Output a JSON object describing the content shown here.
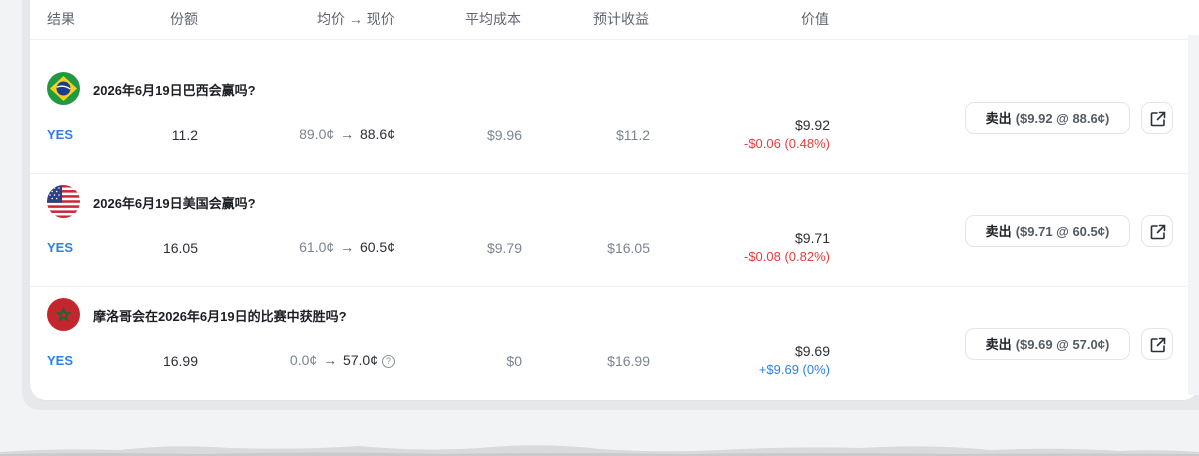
{
  "header": {
    "outcome": "结果",
    "shares": "份额",
    "price": "均价 → 现价",
    "avg_cost": "平均成本",
    "expected_return": "预计收益",
    "value": "价值"
  },
  "colors": {
    "accent_blue": "#2f7fe0",
    "loss_red": "#e03e3e"
  },
  "rows": [
    {
      "flag_icon": "brazil-flag-icon",
      "title": "2026年6月19日巴西会赢吗?",
      "outcome": "YES",
      "shares": "11.2",
      "avg_price": "89.0¢",
      "arrow": "→",
      "current_price": "88.6¢",
      "avg_cost": "$9.96",
      "expected_return": "$11.2",
      "value": "$9.92",
      "value_change": "-$0.06 (0.48%)",
      "sell_label": "卖出",
      "sell_detail": "($9.92 @ 88.6¢)"
    },
    {
      "flag_icon": "usa-flag-icon",
      "title": "2026年6月19日美国会赢吗?",
      "outcome": "YES",
      "shares": "16.05",
      "avg_price": "61.0¢",
      "arrow": "→",
      "current_price": "60.5¢",
      "avg_cost": "$9.79",
      "expected_return": "$16.05",
      "value": "$9.71",
      "value_change": "-$0.08 (0.82%)",
      "sell_label": "卖出",
      "sell_detail": "($9.71 @ 60.5¢)"
    },
    {
      "flag_icon": "morocco-flag-icon",
      "title": "摩洛哥会在2026年6月19日的比赛中获胜吗?",
      "outcome": "YES",
      "shares": "16.99",
      "avg_price": "0.0¢",
      "arrow": "→",
      "current_price": "57.0¢",
      "help_glyph": "?",
      "avg_cost": "$0",
      "expected_return": "$16.99",
      "value": "$9.69",
      "value_change": "+$9.69 (0%)",
      "sell_label": "卖出",
      "sell_detail": "($9.69 @ 57.0¢)"
    }
  ]
}
